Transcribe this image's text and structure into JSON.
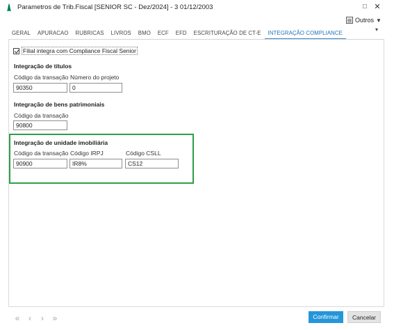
{
  "window": {
    "title": "Parametros de Trib.Fiscal [SENIOR SC - Dez/2024]  - 3 01/12/2003",
    "maximize_icon": "maximize-icon",
    "close_icon": "close-icon"
  },
  "toolbar": {
    "outros_label": "Outros"
  },
  "tabs": [
    {
      "label": "GERAL"
    },
    {
      "label": "APURACAO"
    },
    {
      "label": "RUBRICAS"
    },
    {
      "label": "LIVROS"
    },
    {
      "label": "BMO"
    },
    {
      "label": "ECF"
    },
    {
      "label": "EFD"
    },
    {
      "label": "ESCRITURAÇÃO DE CT-E"
    },
    {
      "label": "INTEGRAÇÃO COMPLIANCE",
      "active": true
    }
  ],
  "compliance": {
    "checkbox_label": "Filial integra com Compliance Fiscal Senior",
    "checked": true
  },
  "titulos": {
    "title": "Integração de títulos",
    "codigo_label": "Código da transação",
    "codigo_value": "90350",
    "projeto_label": "Número do projeto",
    "projeto_value": "0"
  },
  "bens": {
    "title": "Integração de bens patrimoniais",
    "codigo_label": "Código da transação",
    "codigo_value": "90800"
  },
  "imobiliaria": {
    "title": "Integração de unidade imobiliária",
    "codigo_label": "Código da transação",
    "codigo_value": "90900",
    "irpj_label": "Código IRPJ",
    "irpj_value": "IR8%",
    "csll_label": "Código CSLL",
    "csll_value": "CS12"
  },
  "footer": {
    "confirm_label": "Confirmar",
    "cancel_label": "Cancelar"
  },
  "colors": {
    "accent": "#2596d9",
    "highlight": "#2f9e48",
    "active_tab": "#1e73b8"
  }
}
